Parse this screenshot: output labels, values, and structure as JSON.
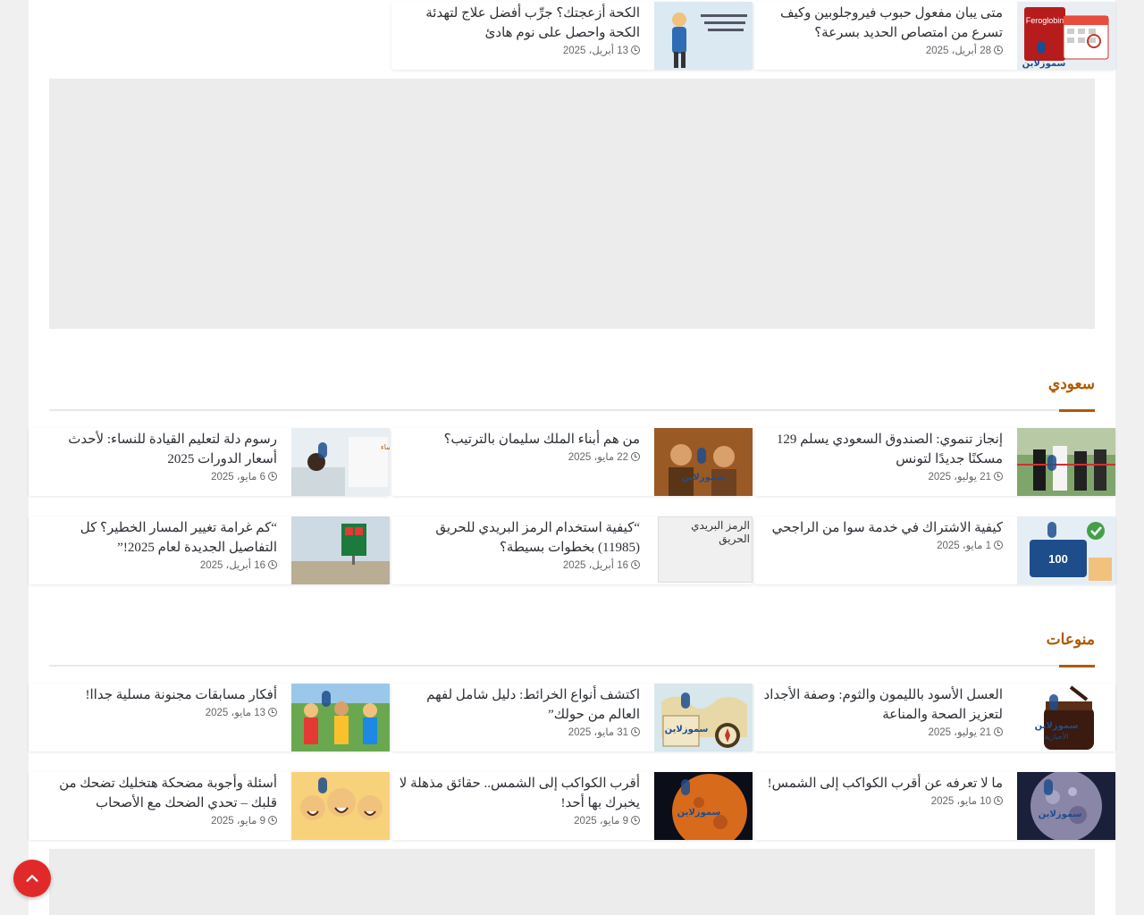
{
  "top_row": [
    {
      "title": "متى يبان مفعول حبوب فيروجلوبين وكيف تسرع من امتصاص الحديد بسرعة؟",
      "date": "28 أبريل، 2025",
      "thumb_text": "Feroglobin"
    },
    {
      "title": "الكحة أزعجتك؟ جرِّب أفضل علاج لتهدئة الكحة واحصل على نوم هادئ",
      "date": "13 أبريل، 2025"
    }
  ],
  "sections": [
    {
      "heading": "سعودي",
      "posts": [
        {
          "title": "إنجاز تنموي: الصندوق السعودي يسلم 129 مسكنًا جديدًا لتونس",
          "date": "21 يوليو، 2025"
        },
        {
          "title": "من هم أبناء الملك سليمان بالترتيب؟",
          "date": "22 مايو، 2025"
        },
        {
          "title": "رسوم دلة لتعليم القيادة للنساء: لأحدث أسعار الدورات 2025",
          "date": "6 مايو، 2025",
          "thumb_text": "مدرسة لتعليم القيادة للنساء"
        },
        {
          "title": "كيفية الاشتراك في خدمة سوا من الراجحي",
          "date": "1 مايو، 2025",
          "thumb_text": "100"
        },
        {
          "title": "“كيفية استخدام الرمز البريدي للحريق (11985) بخطوات بسيطة؟",
          "date": "16 أبريل، 2025",
          "broken_alt": "الرمز البريدي الحريق"
        },
        {
          "title": "“كم غرامة تغيير المسار الخطير؟ كل التفاصيل الجديدة لعام 2025!”",
          "date": "16 أبريل، 2025"
        }
      ]
    },
    {
      "heading": "منوعات",
      "posts": [
        {
          "title": "العسل الأسود بالليمون والثوم: وصفة الأجداد لتعزيز الصحة والمناعة",
          "date": "21 يوليو، 2025"
        },
        {
          "title": "اكتشف أنواع الخرائط: دليل شامل لفهم العالم من حولك”",
          "date": "31 مايو، 2025"
        },
        {
          "title": "أفكار مسابقات مجنونة مسلية جداا!",
          "date": "13 مايو، 2025"
        },
        {
          "title": "ما لا تعرفه عن أقرب الكواكب إلى الشمس!",
          "date": "10 مايو، 2025"
        },
        {
          "title": "أقرب الكواكب إلى الشمس.. حقائق مذهلة لا يخبرك بها أحد!",
          "date": "9 مايو، 2025"
        },
        {
          "title": "أسئلة وأجوبة مضحكة هتخليك تضحك من قلبك – تحدي الضحك مع الأصحاب",
          "date": "9 مايو، 2025"
        }
      ]
    }
  ],
  "watermark": "سموزلاين",
  "watermark_sub": "الأخبارية",
  "icons": {
    "date": "clock-icon",
    "back_to_top": "chevron-up-icon"
  },
  "colors": {
    "accent": "#b05a00",
    "back_to_top": "#e02a2a"
  }
}
